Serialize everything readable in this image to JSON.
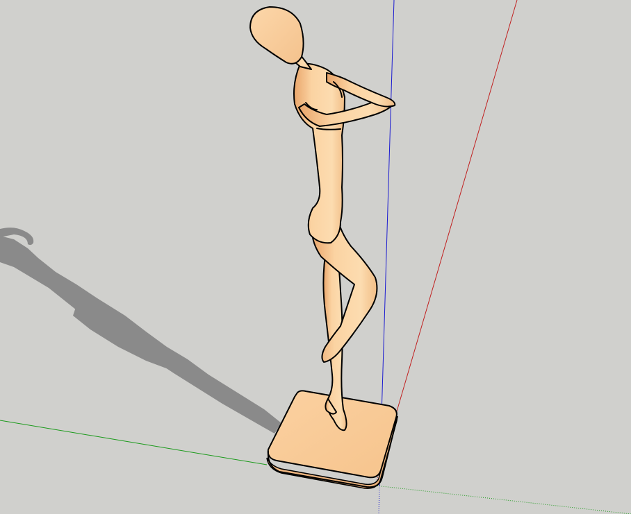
{
  "scene": {
    "background_color": "#d0d0cd",
    "shadow_color": "#8c8c8c",
    "skin_color": "#fbcf9a",
    "skin_shade_color": "#e8a86e",
    "outline_color": "#000000",
    "axis_colors": {
      "red": "#c02020",
      "green": "#1a9a1a",
      "blue": "#1a1ad0"
    },
    "objects": [
      "figure-model",
      "pedestal-base",
      "figure-shadow",
      "axis-lines"
    ]
  }
}
